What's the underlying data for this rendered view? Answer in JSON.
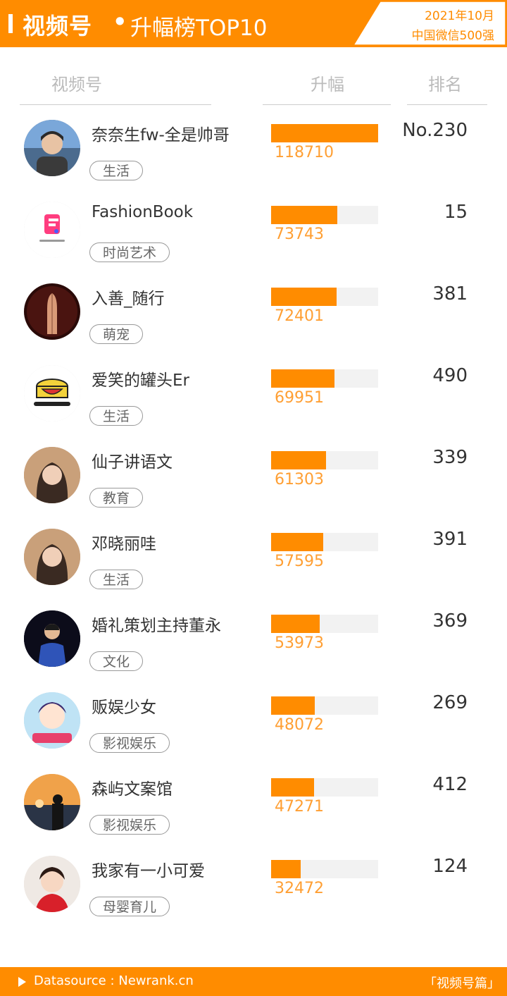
{
  "header": {
    "title_main": "视频号",
    "separator": "•",
    "title_sub": "升幅榜TOP10",
    "badge_line1": "2021年10月",
    "badge_line2": "中国微信500强"
  },
  "columns": {
    "account": "视频号",
    "increase": "升幅",
    "rank": "排名"
  },
  "colors": {
    "brand_orange": "#ff8c00",
    "value_orange": "#ff9f33",
    "bar_track": "#f2f2f2"
  },
  "max_increase": 118710,
  "rows": [
    {
      "name": "奈奈生fw-全是帅哥",
      "tag": "生活",
      "increase": "118710",
      "increase_value": 118710,
      "rank": "No.230",
      "avatar_icon": "avatar-photo-man"
    },
    {
      "name": "FashionBook",
      "tag": "时尚艺术",
      "increase": "73743",
      "increase_value": 73743,
      "rank": "15",
      "avatar_icon": "fashionbook-logo-icon"
    },
    {
      "name": "入善_随行",
      "tag": "萌宠",
      "increase": "72401",
      "increase_value": 72401,
      "rank": "381",
      "avatar_icon": "avatar-praying-hands"
    },
    {
      "name": "爱笑的罐头Er",
      "tag": "生活",
      "increase": "69951",
      "increase_value": 69951,
      "rank": "490",
      "avatar_icon": "laughing-can-logo-icon"
    },
    {
      "name": "仙子讲语文",
      "tag": "教育",
      "increase": "61303",
      "increase_value": 61303,
      "rank": "339",
      "avatar_icon": "avatar-photo-woman"
    },
    {
      "name": "邓晓丽哇",
      "tag": "生活",
      "increase": "57595",
      "increase_value": 57595,
      "rank": "391",
      "avatar_icon": "avatar-photo-woman"
    },
    {
      "name": "婚礼策划主持董永",
      "tag": "文化",
      "increase": "53973",
      "increase_value": 53973,
      "rank": "369",
      "avatar_icon": "avatar-photo-host"
    },
    {
      "name": "贩娱少女",
      "tag": "影视娱乐",
      "increase": "48072",
      "increase_value": 48072,
      "rank": "269",
      "avatar_icon": "avatar-cartoon-girl"
    },
    {
      "name": "森屿文案馆",
      "tag": "影视娱乐",
      "increase": "47271",
      "increase_value": 47271,
      "rank": "412",
      "avatar_icon": "avatar-sunset-silhouette"
    },
    {
      "name": "我家有一小可爱",
      "tag": "母婴育儿",
      "increase": "32472",
      "increase_value": 32472,
      "rank": "124",
      "avatar_icon": "avatar-photo-child"
    }
  ],
  "footer": {
    "play_icon": "play-triangle-icon",
    "source": "Datasource : Newrank.cn",
    "series": "「视频号篇」"
  }
}
